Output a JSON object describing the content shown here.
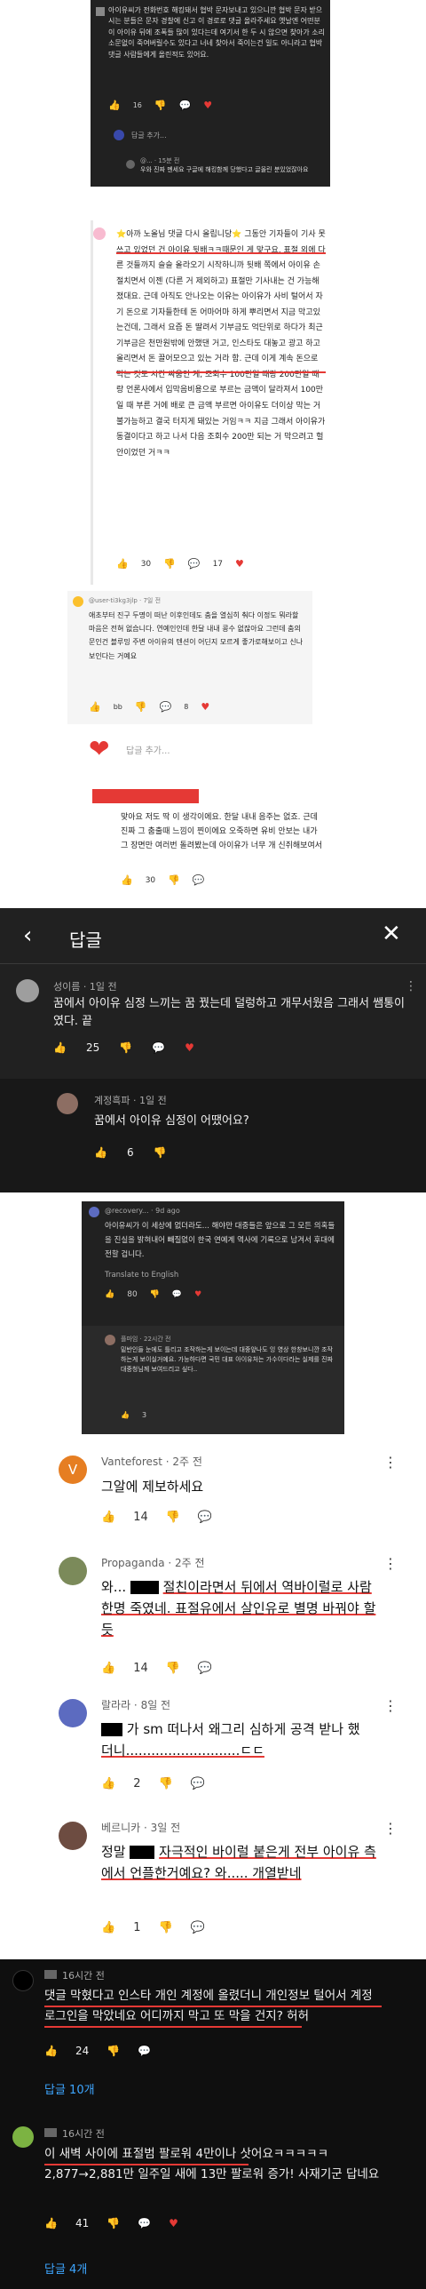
{
  "s1": {
    "body": "아이유씨가 전화번호 해킹돼서 협박 문자보내고 있으니깐 협박 문자 받으시는 분들은 문자 경찰에 신고 이 경로로 댓글 올라주세요 옛날엔 어떤분이 아이유 뒤에 조폭들 많이 있다는데 여기서 한 두 시 않으면 찾아가 소리소문없이 죽여버릴수도 있다고 너네 찾아서 죽이는건 일도 아니라고 협박 댓글 사람들에게 올린적도 있어요.",
    "likes": "16",
    "reply_placeholder": "답글 추가...",
    "sub_meta": "@... · 15분 전",
    "sub_body": "우와 진짜 멘세요 구글에 해킹함께 당했다고 글올린 분있었잖아요"
  },
  "s2": {
    "body": "⭐아까 노올님 댓글 다시 올립니당⭐ 그동안 기자들이 기사 못쓰고 있었던 건 아이유 뒷배ㅋㅋ때문인 게 맞구요, 표절 외에 다른 것들까지 슬슬 올라오기 시작하니까 뒷배 쪽에서 아이유 손절치면서 이젠 (다른 거 제외하고) 표절만 기사내는 건 가능해졌대요. 근데 아직도 안나오는 이유는 아이유가 사비 털어서 자기 돈으로 기자들한테 돈 어마어마 하게 뿌리면서 지금 막고있는건데, 그래서 요즘 돈 딸려서 기부금도 억단위로 하다가 최근 기부금은 천만원밖에 안했댄 거고, 인스타도 대놓고 광고 하고 올리면서 돈 끌어모으고 있는 거라 함. 근데 이게 계속 돈으로 막는 것도 시간 싸움인 게, 조회수 100만일 때랑 200만일 때랑 언론사에서 입막음비용으로 부르는 금액이 달라져서 100만일 때 부른 거에 배로 큰 금액 부르면 아이유도 더이상 막는 거 불가능하고 결국 터지게 돼있는 거임ㅋㅋ 지금 그래서 아이유가 동결이다고 하고 나서 다음 조회수 200만 되는 거 막으려고 헐안이었던 거ㅋㅋ",
    "likes": "30",
    "replies": "17"
  },
  "s3": {
    "meta": "@user-ti3kg3jlp · 7일 전",
    "body": "애초부터 진구 두명이 떠난 이후인데도 춤을 열심히 춰다 이정도 뭐라할 마음은 전혀 없습니다. 연예인인데 한달 내내 콩수 없잖아요 그런데 춤의문인건 블루밍 주변 아이유의 텐션이 어딘지 모르게 좋가로해보이고 신나보인다는 거예요",
    "likes": "bb",
    "replies": "8"
  },
  "s4": {
    "placeholder": "답글 추가...",
    "body": "맞아요 저도 딱 이 생각이에요. 한달 내내 음주는 없죠. 근데 진짜 그 춤출때 느낌이 찐이에요 오죽하면 유비 안보는 내가 그 장면만 여러번 돌려봤는데 아이유가 너무 개 신쥐해보여서",
    "likes": "30"
  },
  "dlg": {
    "title": "답글",
    "c1_name": "성이름 · 1일 전",
    "c1_body": "꿈에서 아이유 심정 느끼는 꿈 꿨는데 덜렁하고 개무서웠음 그래서 쌤통이였다. 끝",
    "c1_likes": "25",
    "c2_name": "계정흑파 · 1일 전",
    "c2_body": "꿈에서 아이유 심정이 어땠어요?",
    "c2_likes": "6"
  },
  "s5": {
    "meta": "@recovery... · 9d ago",
    "body": "아이유씨가 이 세상에 없더라도... 해야만 대중들은 앞으로 그 모든 의혹들을 진실을 밝혀내어 빼질없이 한국 연예계 역사에 기록으로 남겨서 후대에 전할 겁니다.",
    "translate": "Translate to English",
    "likes": "80",
    "sub_meta": "플마임 · 22시간 전",
    "sub_body": "밑반인들 눈에도 틀리고 조작하는게 보이는데 대중앞나도 잉 영상 한창보니깐 조작하는게 보이실거예요. 가능하다면 국민 대표 아이유처는 가수이다라는 실제를 진짜 대중청님께 보여드리고 싶다..",
    "sub_likes": "3"
  },
  "c_v": {
    "name": "Vanteforest · 2주 전",
    "body": "그알에 제보하세요",
    "likes": "14"
  },
  "c_p": {
    "name": "Propaganda · 2주 전",
    "b1": "와...",
    "b2": "절친이라면서 뒤에서 역바이럴로 사람 한명 죽였네. 표절유에서 살인유로 별명 바꿔야 할 듯",
    "likes": "14"
  },
  "c_r": {
    "name": "랄라라 · 8일 전",
    "b1": "가 sm 떠나서 왜그리 심하게 공격 받나 했",
    "b2": "더니...........................ㄷㄷ",
    "likes": "2"
  },
  "c_b": {
    "name": "베르니카 · 3일 전",
    "b1": "정말",
    "b2": "자극적인 바이럴 붙은게 전부 아이유 측에서 언플한거예요? 와..... 개열받네",
    "likes": "1"
  },
  "c_d1": {
    "name": "16시간 전",
    "body": "댓글 막혔다고 인스타 개인 계정에 올렸더니 개인정보 털어서 계정로그인을 막았네요 어디까지 막고 또 막을 건지? 허허",
    "likes": "24",
    "replies": "답글 10개"
  },
  "c_d2": {
    "name": "16시간 전",
    "body": "이 새벽 사이에 표절범 팔로워 4만이나 삿어요ㅋㅋㅋㅋㅋ 2,877→2,881만 일주일 새에 13만 팔로워 증가! 사재기군 답네요",
    "likes": "41",
    "replies": "답글 4개"
  }
}
